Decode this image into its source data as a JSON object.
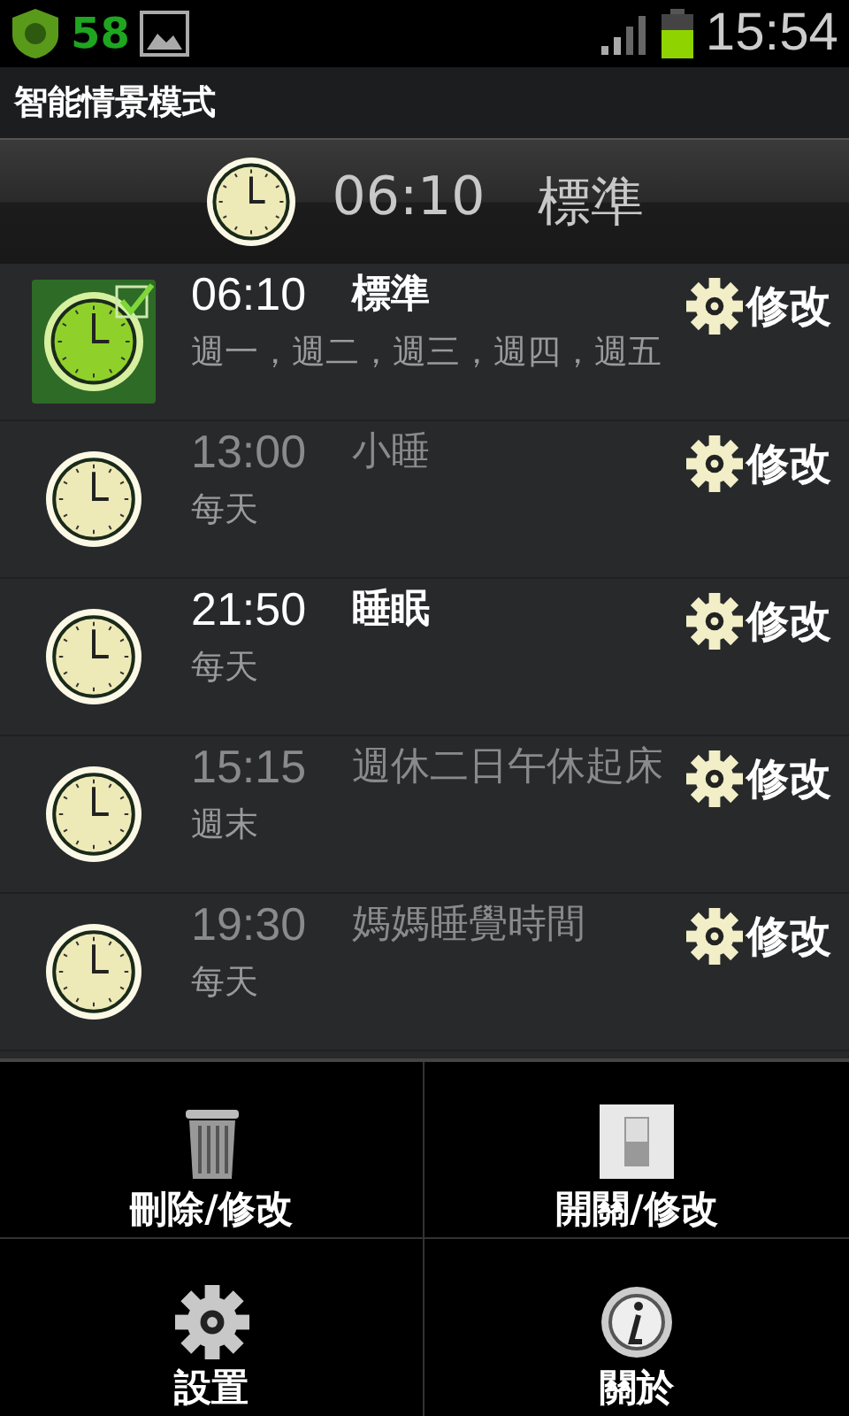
{
  "status_bar": {
    "badge": "58",
    "time": "15:54"
  },
  "app_title": "智能情景模式",
  "current_mode": {
    "time": "06:10",
    "name": "標準"
  },
  "modes": [
    {
      "time": "06:10",
      "name": "標準",
      "days": "週一，週二，週三，週四，週五",
      "enabled": true,
      "selected": true,
      "edit_label": "修改"
    },
    {
      "time": "13:00",
      "name": "小睡",
      "days": "每天",
      "enabled": false,
      "selected": false,
      "edit_label": "修改"
    },
    {
      "time": "21:50",
      "name": "睡眠",
      "days": "每天",
      "enabled": true,
      "selected": false,
      "edit_label": "修改"
    },
    {
      "time": "15:15",
      "name": "週休二日午休起床",
      "days": "週末",
      "enabled": false,
      "selected": false,
      "edit_label": "修改"
    },
    {
      "time": "19:30",
      "name": "媽媽睡覺時間",
      "days": "每天",
      "enabled": false,
      "selected": false,
      "edit_label": "修改"
    }
  ],
  "menu": [
    {
      "kind": "delete",
      "label": "刪除/修改"
    },
    {
      "kind": "toggle",
      "label": "開關/修改"
    },
    {
      "kind": "settings",
      "label": "設置"
    },
    {
      "kind": "about",
      "label": "關於"
    }
  ]
}
